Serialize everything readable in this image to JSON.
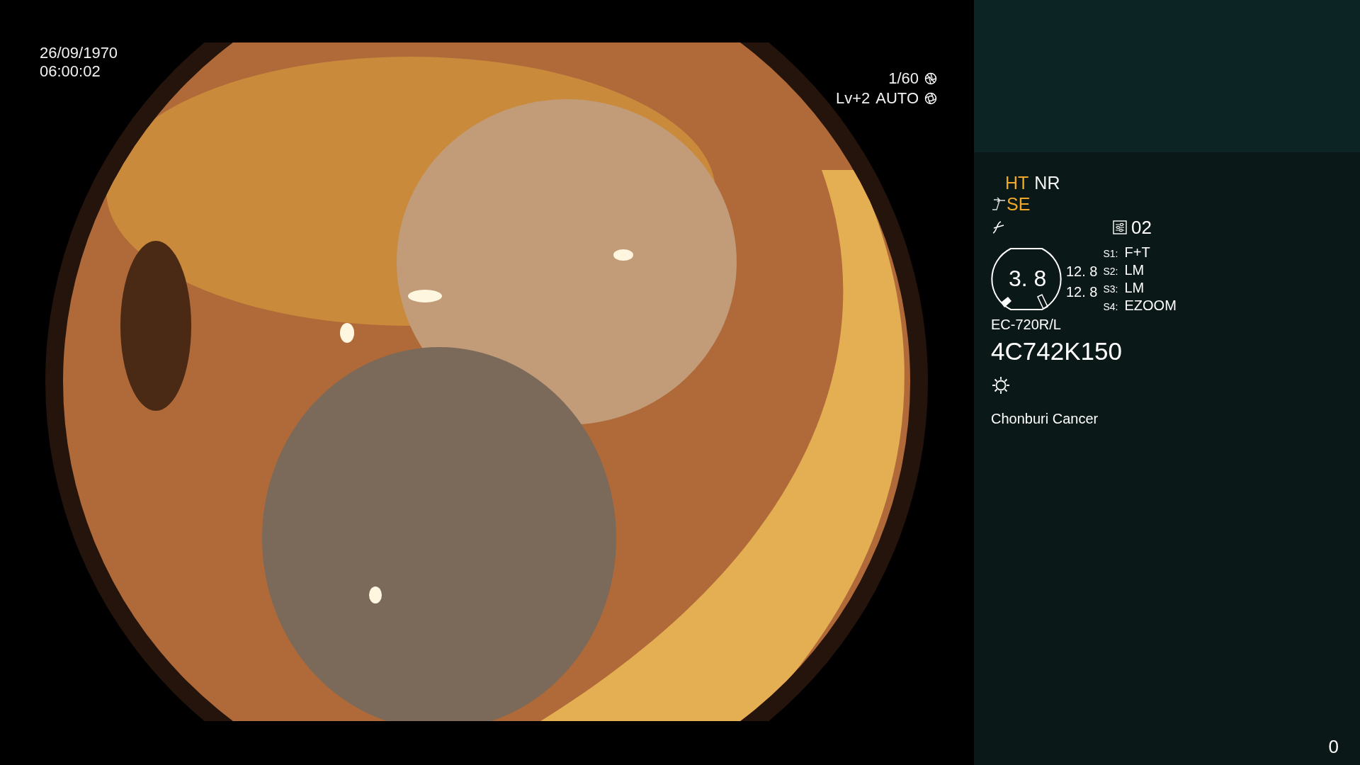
{
  "image_view": {
    "date": "26/09/1970",
    "time": "06:00:02",
    "shutter": "1/60",
    "level": "Lv+2",
    "iris": "AUTO"
  },
  "info_panel": {
    "modes": [
      {
        "label": "HT",
        "active": true
      },
      {
        "label": "NR",
        "active": false
      }
    ],
    "enhance": {
      "label": "SE",
      "active": true
    },
    "preset": "02",
    "zoom_gauge": {
      "value": "3. 8",
      "readings": [
        "12. 8",
        "12. 8"
      ]
    },
    "switches": [
      {
        "key": "S1:",
        "value": "F+T"
      },
      {
        "key": "S2:",
        "value": "LM"
      },
      {
        "key": "S3:",
        "value": "LM"
      },
      {
        "key": "S4:",
        "value": "EZOOM"
      }
    ],
    "scope_model": "EC-720R/L",
    "serial": "4C742K150",
    "institution": "Chonburi Cancer"
  },
  "counter": "0"
}
